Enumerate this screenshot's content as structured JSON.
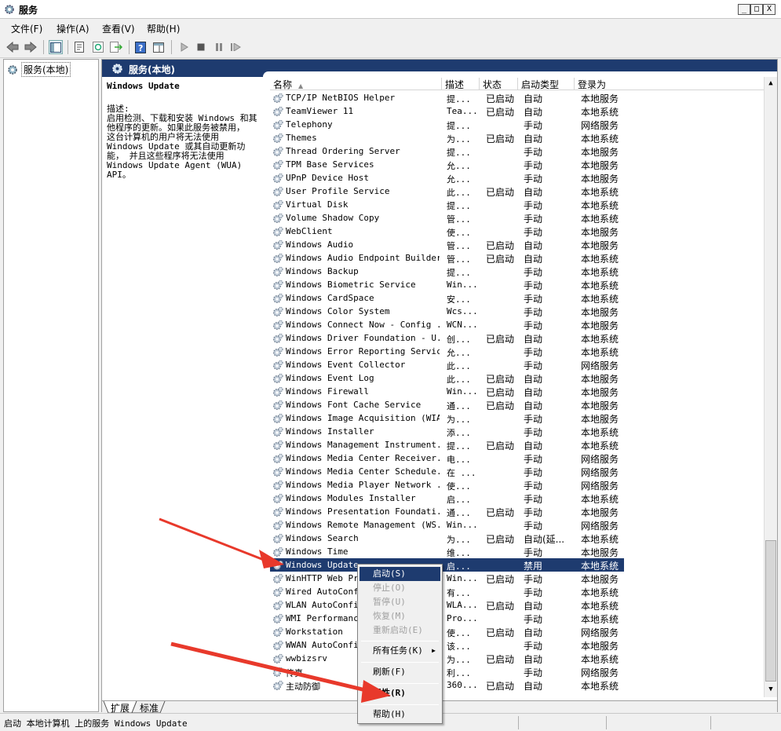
{
  "window": {
    "title": "服务",
    "min_label": "_",
    "max_label": "□",
    "close_label": "X"
  },
  "menubar": [
    "文件(F)",
    "操作(A)",
    "查看(V)",
    "帮助(H)"
  ],
  "tree": {
    "root_label": "服务(本地)"
  },
  "panel": {
    "header": "服务(本地)"
  },
  "description": {
    "title": "Windows Update",
    "label": "描述:",
    "text": "启用检测、下载和安装 Windows 和其\n他程序的更新。如果此服务被禁用，\n这台计算机的用户将无法使用\nWindows Update 或其自动更新功\n能， 并且这些程序将无法使用\nWindows Update Agent (WUA) API。"
  },
  "columns": [
    "名称",
    "描述",
    "状态",
    "启动类型",
    "登录为"
  ],
  "services": [
    [
      "TCP/IP NetBIOS Helper",
      "提...",
      "已启动",
      "自动",
      "本地服务"
    ],
    [
      "TeamViewer 11",
      "Tea...",
      "已启动",
      "自动",
      "本地系统"
    ],
    [
      "Telephony",
      "提...",
      "",
      "手动",
      "网络服务"
    ],
    [
      "Themes",
      "为...",
      "已启动",
      "自动",
      "本地系统"
    ],
    [
      "Thread Ordering Server",
      "提...",
      "",
      "手动",
      "本地服务"
    ],
    [
      "TPM Base Services",
      "允...",
      "",
      "手动",
      "本地服务"
    ],
    [
      "UPnP Device Host",
      "允...",
      "",
      "手动",
      "本地服务"
    ],
    [
      "User Profile Service",
      "此...",
      "已启动",
      "自动",
      "本地系统"
    ],
    [
      "Virtual Disk",
      "提...",
      "",
      "手动",
      "本地系统"
    ],
    [
      "Volume Shadow Copy",
      "管...",
      "",
      "手动",
      "本地系统"
    ],
    [
      "WebClient",
      "使...",
      "",
      "手动",
      "本地服务"
    ],
    [
      "Windows Audio",
      "管...",
      "已启动",
      "自动",
      "本地服务"
    ],
    [
      "Windows Audio Endpoint Builder",
      "管...",
      "已启动",
      "自动",
      "本地系统"
    ],
    [
      "Windows Backup",
      "提...",
      "",
      "手动",
      "本地系统"
    ],
    [
      "Windows Biometric Service",
      "Win...",
      "",
      "手动",
      "本地系统"
    ],
    [
      "Windows CardSpace",
      "安...",
      "",
      "手动",
      "本地系统"
    ],
    [
      "Windows Color System",
      "Wcs...",
      "",
      "手动",
      "本地服务"
    ],
    [
      "Windows Connect Now - Config ...",
      "WCN...",
      "",
      "手动",
      "本地服务"
    ],
    [
      "Windows Driver Foundation - U...",
      "创...",
      "已启动",
      "自动",
      "本地系统"
    ],
    [
      "Windows Error Reporting Service",
      "允...",
      "",
      "手动",
      "本地系统"
    ],
    [
      "Windows Event Collector",
      "此...",
      "",
      "手动",
      "网络服务"
    ],
    [
      "Windows Event Log",
      "此...",
      "已启动",
      "自动",
      "本地服务"
    ],
    [
      "Windows Firewall",
      "Win...",
      "已启动",
      "自动",
      "本地服务"
    ],
    [
      "Windows Font Cache Service",
      "通...",
      "已启动",
      "自动",
      "本地服务"
    ],
    [
      "Windows Image Acquisition (WIA)",
      "为...",
      "",
      "手动",
      "本地服务"
    ],
    [
      "Windows Installer",
      "添...",
      "",
      "手动",
      "本地系统"
    ],
    [
      "Windows Management Instrument...",
      "提...",
      "已启动",
      "自动",
      "本地系统"
    ],
    [
      "Windows Media Center Receiver...",
      "电...",
      "",
      "手动",
      "网络服务"
    ],
    [
      "Windows Media Center Schedule...",
      "在 ...",
      "",
      "手动",
      "网络服务"
    ],
    [
      "Windows Media Player Network ...",
      "使...",
      "",
      "手动",
      "网络服务"
    ],
    [
      "Windows Modules Installer",
      "启...",
      "",
      "手动",
      "本地系统"
    ],
    [
      "Windows Presentation Foundati...",
      "通...",
      "已启动",
      "手动",
      "本地服务"
    ],
    [
      "Windows Remote Management (WS...",
      "Win...",
      "",
      "手动",
      "网络服务"
    ],
    [
      "Windows Search",
      "为...",
      "已启动",
      "自动(延...",
      "本地系统"
    ],
    [
      "Windows Time",
      "维...",
      "",
      "手动",
      "本地服务"
    ],
    [
      "Windows Update",
      "启...",
      "",
      "禁用",
      "本地系统"
    ],
    [
      "WinHTTP Web Pro",
      "Win...",
      "已启动",
      "手动",
      "本地服务"
    ],
    [
      "Wired AutoConfi",
      "有...",
      "",
      "手动",
      "本地系统"
    ],
    [
      "WLAN AutoConfig",
      "WLA...",
      "已启动",
      "自动",
      "本地系统"
    ],
    [
      "WMI Performance",
      "Pro...",
      "",
      "手动",
      "本地系统"
    ],
    [
      "Workstation",
      "使...",
      "已启动",
      "自动",
      "网络服务"
    ],
    [
      "WWAN AutoConfig",
      "该...",
      "",
      "手动",
      "本地服务"
    ],
    [
      "wwbizsrv",
      "为...",
      "已启动",
      "自动",
      "本地系统"
    ],
    [
      "传真",
      "利...",
      "",
      "手动",
      "网络服务"
    ],
    [
      "主动防御",
      "360...",
      "已启动",
      "自动",
      "本地系统"
    ]
  ],
  "selected_service": "Windows Update",
  "context_menu": {
    "start": "启动(S)",
    "stop": "停止(O)",
    "pause": "暂停(U)",
    "resume": "恢复(M)",
    "restart": "重新启动(E)",
    "all_tasks": "所有任务(K)",
    "refresh": "刷新(F)",
    "properties": "属性(R)",
    "help": "帮助(H)"
  },
  "tabs": {
    "extended": "扩展",
    "standard": "标准"
  },
  "statusbar": {
    "text": "启动 本地计算机 上的服务 Windows Update"
  },
  "colors": {
    "header_bg": "#1e3b6f",
    "selection": "#1e3b6f",
    "annotation_arrow": "#e8392b"
  }
}
